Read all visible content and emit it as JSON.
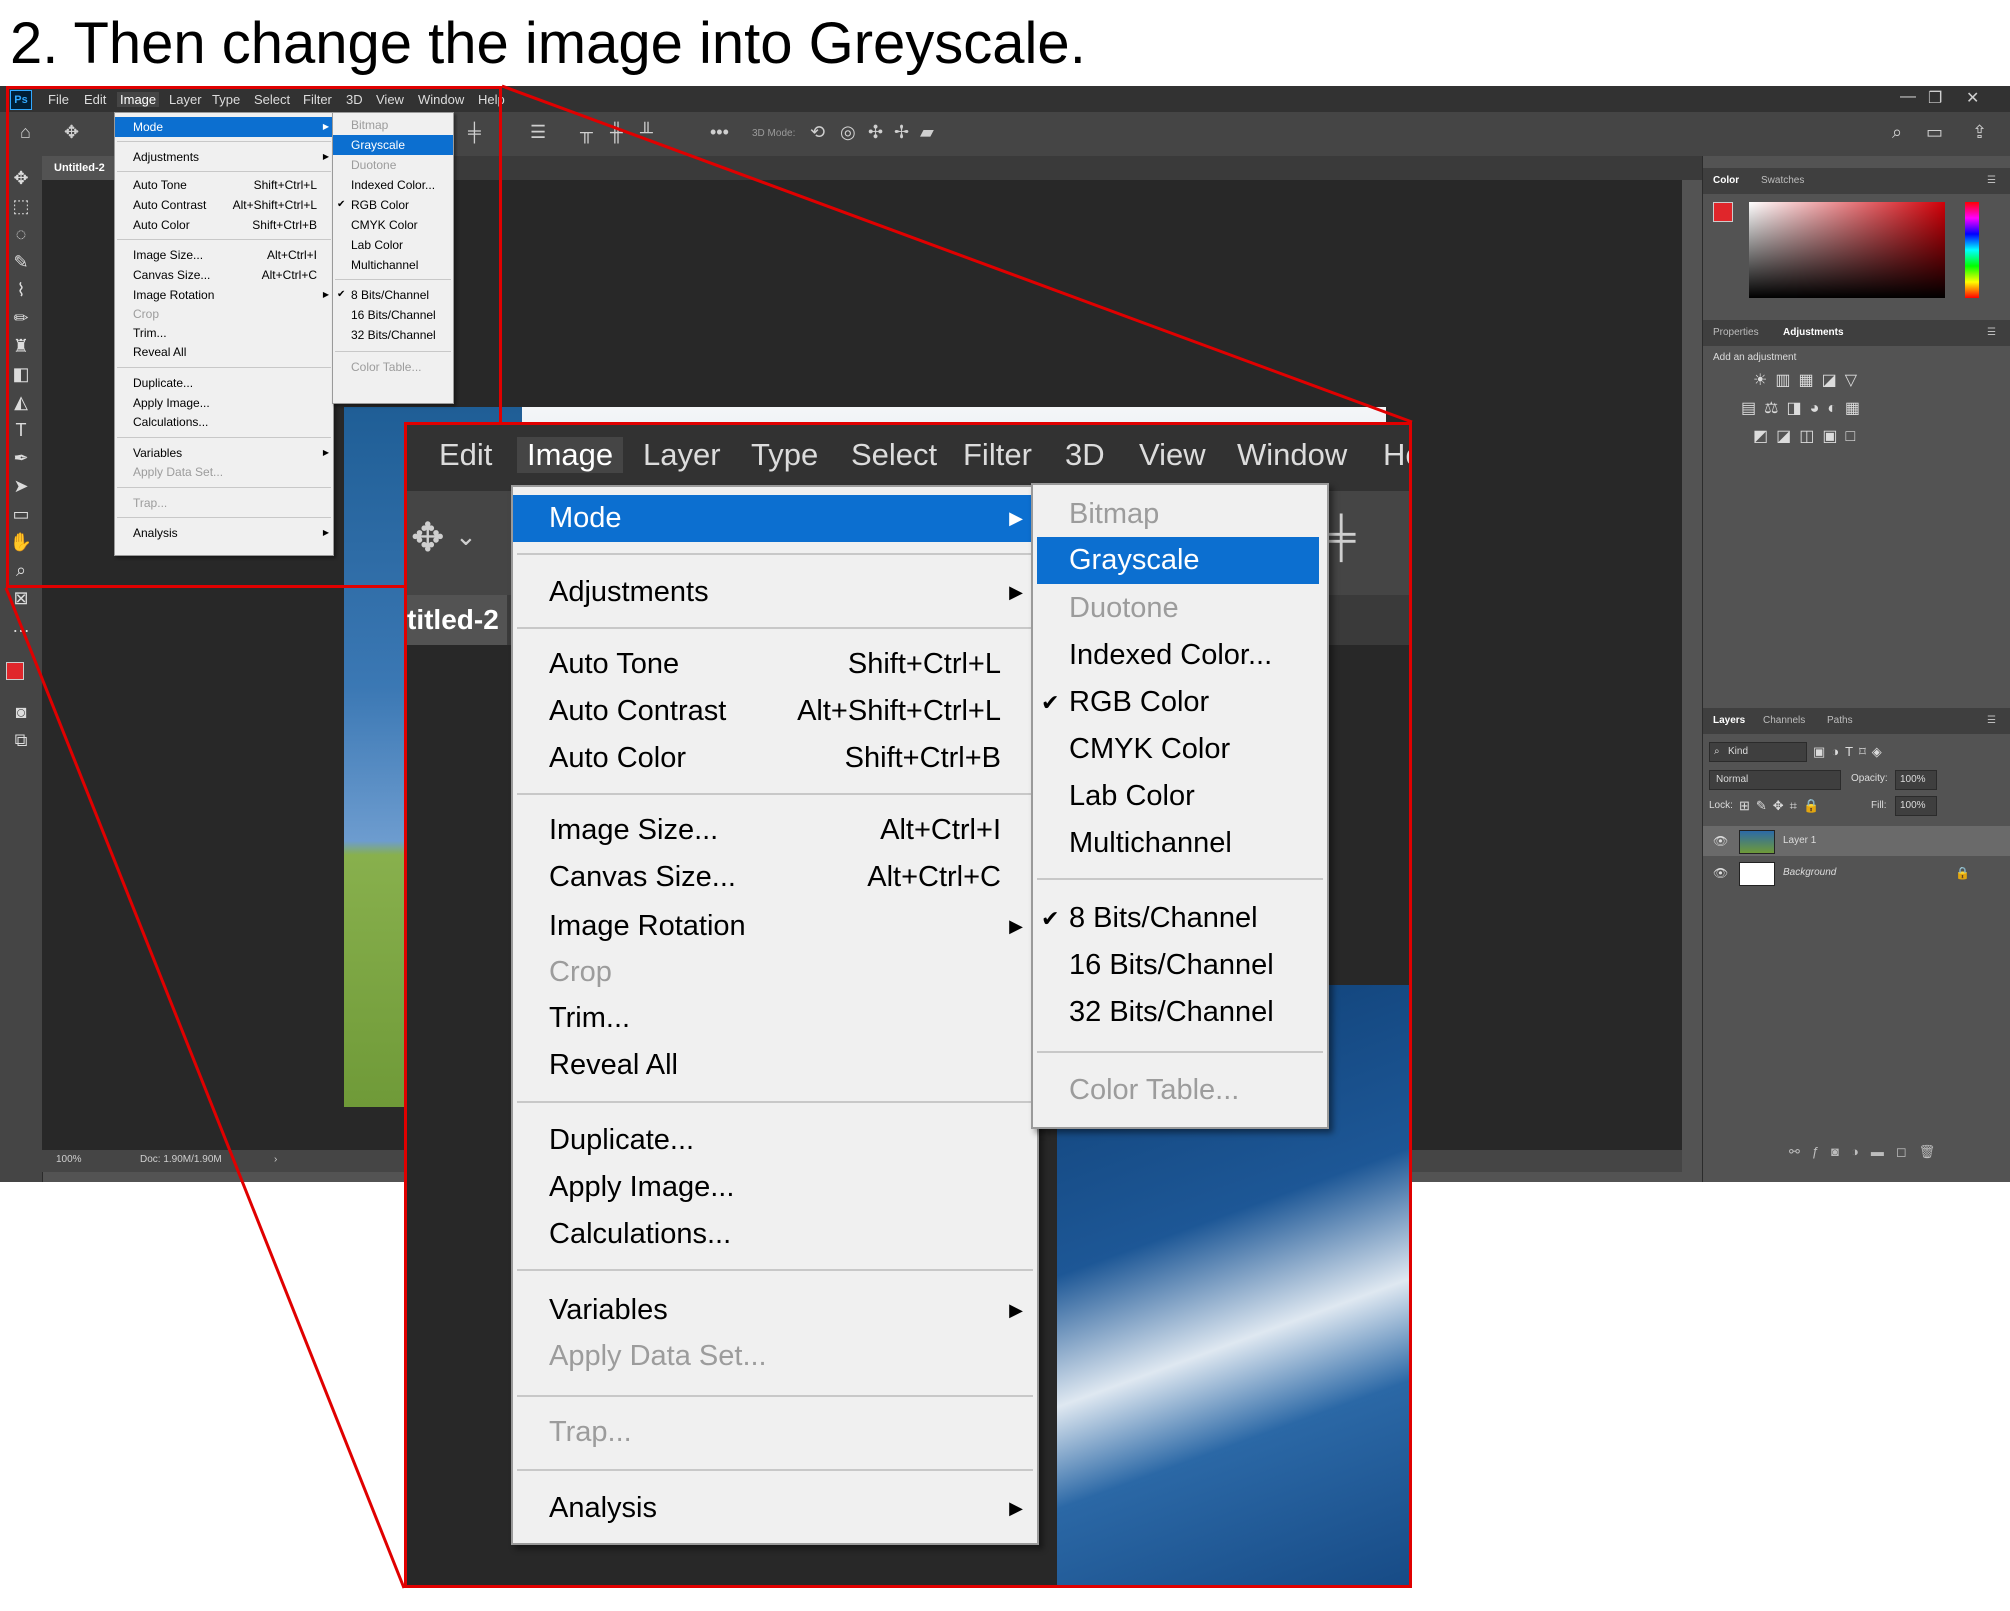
{
  "instruction": "2. Then change the image into Greyscale.",
  "app": {
    "logo": "Ps",
    "menubar": [
      "File",
      "Edit",
      "Image",
      "Layer",
      "Type",
      "Select",
      "Filter",
      "3D",
      "View",
      "Window",
      "Help"
    ],
    "active_menu": "Image",
    "options_bar": {
      "mode_3d_label": "3D Mode:"
    },
    "document_tab": "Untitled-2",
    "status": {
      "zoom": "100%",
      "doc": "Doc: 1.90M/1.90M"
    },
    "window_buttons": [
      "—",
      "❐",
      "✕"
    ]
  },
  "image_menu": {
    "items": [
      {
        "label": "Mode",
        "shortcut": "",
        "submenu": true,
        "highlighted": true,
        "disabled": false
      },
      {
        "sep": true
      },
      {
        "label": "Adjustments",
        "shortcut": "",
        "submenu": true
      },
      {
        "sep": true
      },
      {
        "label": "Auto Tone",
        "shortcut": "Shift+Ctrl+L"
      },
      {
        "label": "Auto Contrast",
        "shortcut": "Alt+Shift+Ctrl+L"
      },
      {
        "label": "Auto Color",
        "shortcut": "Shift+Ctrl+B"
      },
      {
        "sep": true
      },
      {
        "label": "Image Size...",
        "shortcut": "Alt+Ctrl+I"
      },
      {
        "label": "Canvas Size...",
        "shortcut": "Alt+Ctrl+C"
      },
      {
        "label": "Image Rotation",
        "shortcut": "",
        "submenu": true
      },
      {
        "label": "Crop",
        "shortcut": "",
        "disabled": true
      },
      {
        "label": "Trim...",
        "shortcut": ""
      },
      {
        "label": "Reveal All",
        "shortcut": ""
      },
      {
        "sep": true
      },
      {
        "label": "Duplicate...",
        "shortcut": ""
      },
      {
        "label": "Apply Image...",
        "shortcut": ""
      },
      {
        "label": "Calculations...",
        "shortcut": ""
      },
      {
        "sep": true
      },
      {
        "label": "Variables",
        "shortcut": "",
        "submenu": true
      },
      {
        "label": "Apply Data Set...",
        "shortcut": "",
        "disabled": true
      },
      {
        "sep": true
      },
      {
        "label": "Trap...",
        "shortcut": "",
        "disabled": true
      },
      {
        "sep": true
      },
      {
        "label": "Analysis",
        "shortcut": "",
        "submenu": true
      }
    ]
  },
  "mode_submenu": {
    "items": [
      {
        "label": "Bitmap",
        "disabled": true
      },
      {
        "label": "Grayscale",
        "highlighted": true
      },
      {
        "label": "Duotone",
        "disabled": true
      },
      {
        "label": "Indexed Color..."
      },
      {
        "label": "RGB Color",
        "checked": true
      },
      {
        "label": "CMYK Color"
      },
      {
        "label": "Lab Color"
      },
      {
        "label": "Multichannel"
      },
      {
        "sep": true
      },
      {
        "label": "8 Bits/Channel",
        "checked": true
      },
      {
        "label": "16 Bits/Channel"
      },
      {
        "label": "32 Bits/Channel"
      },
      {
        "sep": true
      },
      {
        "label": "Color Table...",
        "disabled": true
      }
    ]
  },
  "panels": {
    "color_tabs": [
      "Color",
      "Swatches"
    ],
    "adjust_tabs": [
      "Properties",
      "Adjustments"
    ],
    "add_adjustment": "Add an adjustment",
    "layers_tabs": [
      "Layers",
      "Channels",
      "Paths"
    ],
    "kind_label": "Kind",
    "blend_mode": "Normal",
    "opacity_label": "Opacity:",
    "opacity_value": "100%",
    "lock_label": "Lock:",
    "fill_label": "Fill:",
    "fill_value": "100%",
    "layers": [
      "Layer 1",
      "Background"
    ],
    "colors": {
      "foreground": "#e0262b",
      "background": "#ffffff",
      "highlight": "#0c6fd0",
      "callout": "#e00000"
    }
  }
}
